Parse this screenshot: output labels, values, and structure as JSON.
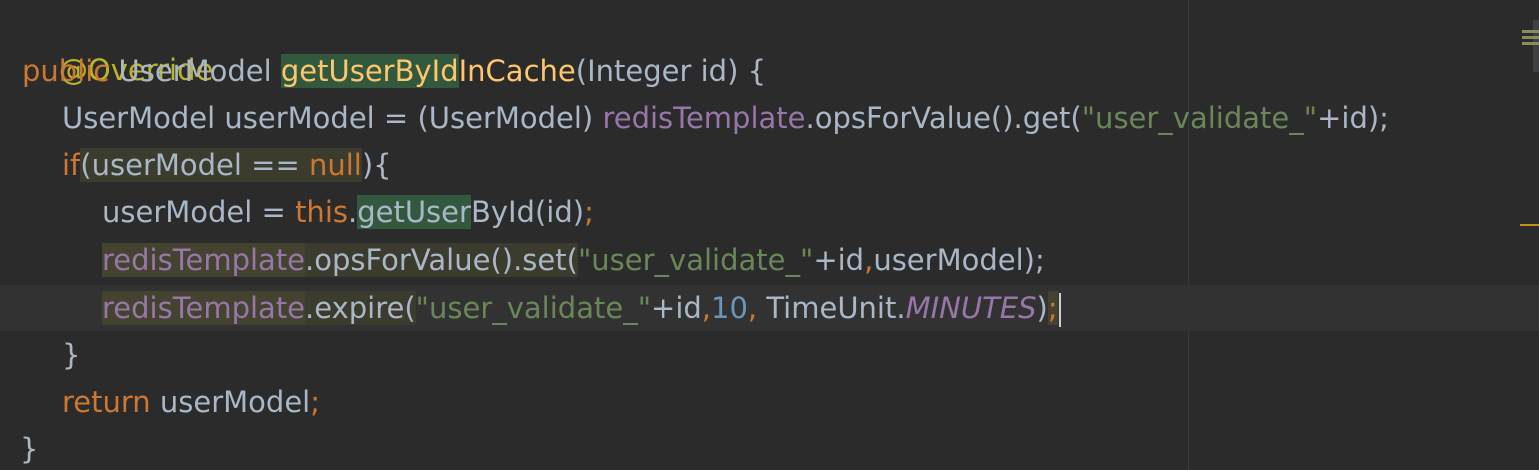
{
  "editor": {
    "lines": {
      "line1": {
        "annotation": "@Override"
      },
      "line2": {
        "kw_public": "public ",
        "return_type": "UserModel ",
        "method_name_part1": "getUserById",
        "method_name_part2": "InCache",
        "params": "(Integer id) {"
      },
      "line3": {
        "decl": "UserModel userModel = (UserModel) ",
        "field": "redisTemplate",
        "call": ".opsForValue().get(",
        "str": "\"user_validate_\"",
        "tail": "+id);"
      },
      "line4": {
        "kw_if": "if",
        "open": "(",
        "cond": "userModel == ",
        "kw_null": "null",
        "close": "){"
      },
      "line5": {
        "assign": "userModel = ",
        "kw_this": "this",
        "dot": ".",
        "method_part1": "getUser",
        "method_part2": "ById(id)",
        "semi": ";"
      },
      "line6": {
        "field": "redisTemplate",
        "call": ".opsForValue().set(",
        "str": "\"user_validate_\"",
        "args": "+id",
        "comma": ",",
        "tail": "userModel);"
      },
      "line7": {
        "field": "redisTemplate",
        "call": ".expire(",
        "str": "\"user_validate_\"",
        "args": "+id",
        "comma1": ",",
        "num": "10",
        "comma2": ",",
        "unit": " TimeUnit.",
        "const": "MINUTES",
        "close": ")",
        "semi": ";"
      },
      "line8": {
        "brace": "}"
      },
      "line9": {
        "kw_return": "return ",
        "var": "userModel",
        "semi": ";"
      },
      "line10": {
        "brace": "}"
      }
    }
  },
  "colors": {
    "background": "#2b2b2b",
    "keyword": "#cc7832",
    "annotation": "#bbb529",
    "method_decl": "#ffc66d",
    "field": "#9876aa",
    "string": "#6a8759",
    "number": "#6897bb",
    "plain": "#a9b7c6",
    "usage_highlight": "#32593d"
  }
}
